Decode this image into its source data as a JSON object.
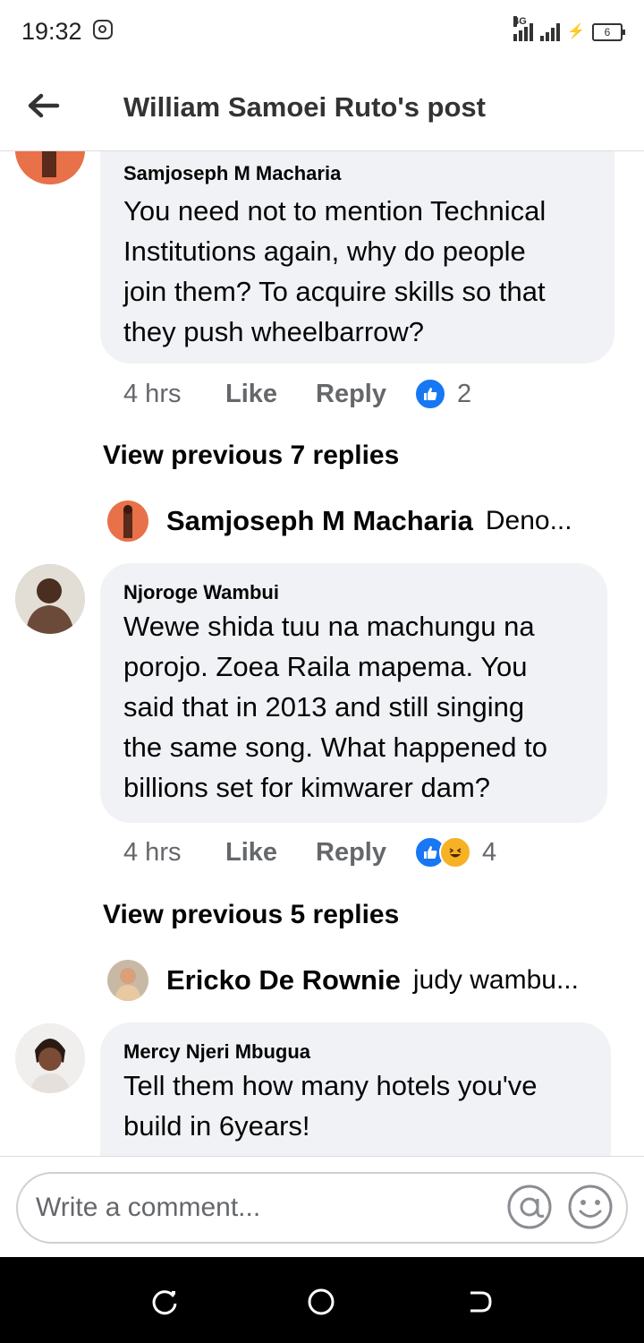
{
  "status_bar": {
    "time": "19:32",
    "network": "4G",
    "battery": "6"
  },
  "header": {
    "title": "William Samoei Ruto's post"
  },
  "comments": [
    {
      "author": "Samjoseph M Macharia",
      "lines": [
        "You need not to mention Technical",
        "Institutions again, why do people",
        "join them? To acquire skills so that",
        "they push wheelbarrow?"
      ],
      "time": "4 hrs",
      "like_label": "Like",
      "reply_label": "Reply",
      "reactions": [
        "like"
      ],
      "reaction_count": "2"
    },
    {
      "author": "Njoroge Wambui",
      "lines": [
        "Wewe shida tuu na machungu na",
        "porojo. Zoea Raila mapema. You",
        "said that in 2013 and still singing",
        "the same song. What happened to",
        "billions set for kimwarer dam?"
      ],
      "time": "4 hrs",
      "like_label": "Like",
      "reply_label": "Reply",
      "reactions": [
        "like",
        "haha"
      ],
      "reaction_count": "4"
    },
    {
      "author": "Mercy Njeri Mbugua",
      "lines": [
        "Tell them how many hotels you've",
        "build in 6years!"
      ]
    }
  ],
  "reply_threads": [
    {
      "view_previous": "View previous 7 replies",
      "author": "Samjoseph M Macharia",
      "snippet": "Deno..."
    },
    {
      "view_previous": "View previous 5 replies",
      "author": "Ericko De Rownie",
      "snippet": "judy wambu..."
    }
  ],
  "composer": {
    "placeholder": "Write a comment..."
  },
  "colors": {
    "bubble": "#f0f2f5",
    "meta_text": "#65676b",
    "like_blue": "#1877f2",
    "haha_yellow": "#f7b125"
  }
}
